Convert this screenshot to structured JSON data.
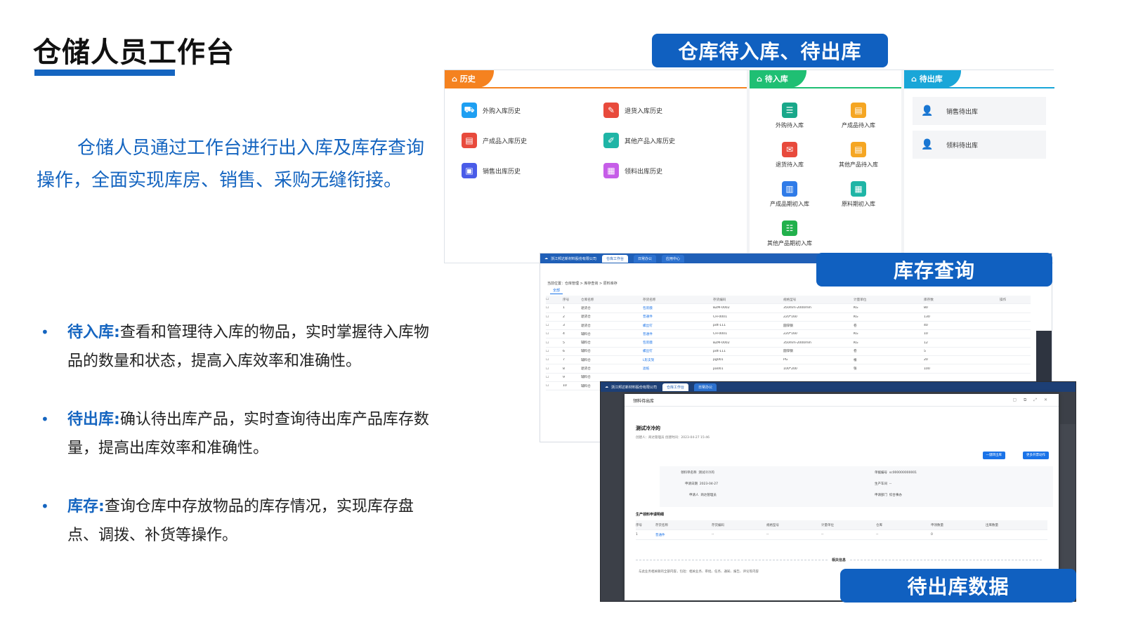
{
  "slide": {
    "title": "仓储人员工作台",
    "intro": "仓储人员通过工作台进行出入库及库存查询操作，全面实现库房、销售、采购无缝衔接。",
    "bullets": [
      {
        "term": "待入库:",
        "text": "查看和管理待入库的物品，实时掌握待入库物品的数量和状态，提高入库效率和准确性。"
      },
      {
        "term": "待出库:",
        "text": "确认待出库产品，实时查询待出库产品库存数量，提高出库效率和准确性。"
      },
      {
        "term": "库存:",
        "text": "查询仓库中存放物品的库存情况，实现库存盘点、调拨、补货等操作。"
      }
    ]
  },
  "callouts": {
    "pending": "仓库待入库、待出库",
    "inventory": "库存查询",
    "outbound": "待出库数据"
  },
  "workbench": {
    "history": {
      "tab": "历史",
      "color": "#f5821f",
      "items": [
        {
          "label": "外购入库历史",
          "icon": "cart-icon",
          "color": "#1e9ff2"
        },
        {
          "label": "退货入库历史",
          "icon": "return-doc-icon",
          "color": "#e84a3c"
        },
        {
          "label": "产成品入库历史",
          "icon": "doc-icon",
          "color": "#e84a3c"
        },
        {
          "label": "其他产品入库历史",
          "icon": "edit-doc-icon",
          "color": "#1fb5a6"
        },
        {
          "label": "销售出库历史",
          "icon": "box-icon",
          "color": "#4a5ce8"
        },
        {
          "label": "领料出库历史",
          "icon": "grid-icon",
          "color": "#c65de8"
        }
      ]
    },
    "inbound": {
      "tab": "待入库",
      "color": "#1fbf73",
      "items": [
        {
          "label": "外购待入库",
          "icon": "list-icon",
          "color": "#19a88a"
        },
        {
          "label": "产成品待入库",
          "icon": "doc-icon",
          "color": "#f5a623"
        },
        {
          "label": "退货待入库",
          "icon": "message-icon",
          "color": "#e84a3c"
        },
        {
          "label": "其他产品待入库",
          "icon": "doc-icon",
          "color": "#f5a623"
        },
        {
          "label": "产成品期初入库",
          "icon": "drawer-icon",
          "color": "#2f7be8"
        },
        {
          "label": "原料期初入库",
          "icon": "calendar-icon",
          "color": "#1fb5a6"
        },
        {
          "label": "其他产品期初入库",
          "icon": "checklist-icon",
          "color": "#22b14c"
        }
      ]
    },
    "outbound": {
      "tab": "待出库",
      "color": "#1aa6d8",
      "items": [
        {
          "label": "销售待出库",
          "icon": "user-icon",
          "color": "#2f7be8"
        },
        {
          "label": "领料待出库",
          "icon": "user-icon",
          "color": "#22b14c"
        }
      ]
    }
  },
  "inventory_window": {
    "company": "浙江邦达新材料股份有限公司",
    "tabs": [
      "仓库工作台",
      "日常办公",
      "应用中心"
    ],
    "crumb": "当前位置：仓库管理 > 库存查询 > 原料库存",
    "filter_tab": "全部",
    "columns": [
      "序号",
      "仓库名称",
      "存货名称",
      "存货编码",
      "规格型号",
      "计量单位",
      "库存数",
      "操作"
    ],
    "rows": [
      [
        "1",
        "退货仓",
        "包装膜",
        "BZM-0002",
        "350mm-2000mm",
        "KG",
        "80"
      ],
      [
        "2",
        "退货仓",
        "普通件",
        "CH-0001",
        "220*160",
        "KG",
        "130"
      ],
      [
        "3",
        "退货仓",
        "螺丝钉",
        "pdt-111",
        "圆锌钢",
        "卷",
        "40"
      ],
      [
        "4",
        "辅料仓",
        "普通件",
        "CH-0001",
        "220*160",
        "KG",
        "10"
      ],
      [
        "5",
        "辅料仓",
        "包装膜",
        "BZM-0002",
        "350mm-2000mm",
        "KG",
        "12"
      ],
      [
        "6",
        "辅料仓",
        "螺丝钉",
        "pdt-111",
        "圆锌钢",
        "卷",
        "5"
      ],
      [
        "7",
        "辅料仓",
        "L形支架",
        "pg001",
        "PG",
        "根",
        "20"
      ],
      [
        "8",
        "退货仓",
        "滤纸",
        "pa001",
        "100*200",
        "张",
        "100"
      ],
      [
        "9",
        "辅料仓",
        "",
        "",
        "",
        "",
        ""
      ],
      [
        "10",
        "辅料仓",
        "",
        "",
        "",
        "",
        ""
      ]
    ]
  },
  "outbound_window": {
    "company": "浙江邦达新材料股份有限公司",
    "tabs": [
      "仓库工作台",
      "日常办公"
    ],
    "modal_title": "领料待出库",
    "doc_name": "测试冷冷的",
    "meta": "创建人：商达管理员  创建时间：2023-04-27 15:46",
    "buttons": [
      "一键转出库",
      "更多开票动作"
    ],
    "fields": [
      {
        "label": "领料单名称",
        "value": "测试冷冷的"
      },
      {
        "label": "单据编号",
        "value": "sc000000000001"
      },
      {
        "label": "申请日期",
        "value": "2023-04-27"
      },
      {
        "label": "生产车间",
        "value": "--"
      },
      {
        "label": "申请人",
        "value": "商达管理员"
      },
      {
        "label": "申请部门",
        "value": "综合事办"
      }
    ],
    "section": "生产领料申请明细",
    "columns": [
      "序号",
      "存货名称",
      "存货编码",
      "规格型号",
      "计量单位",
      "仓库",
      "申领数量",
      "出库数量"
    ],
    "rows": [
      [
        "1",
        "普通件",
        "--",
        "--",
        "--",
        "--",
        "0",
        ""
      ]
    ],
    "related": "相关信息",
    "note": "与此业务相关联的全部内容，包括：相关业务、审批、任务、通知、报告、评论等内容"
  }
}
